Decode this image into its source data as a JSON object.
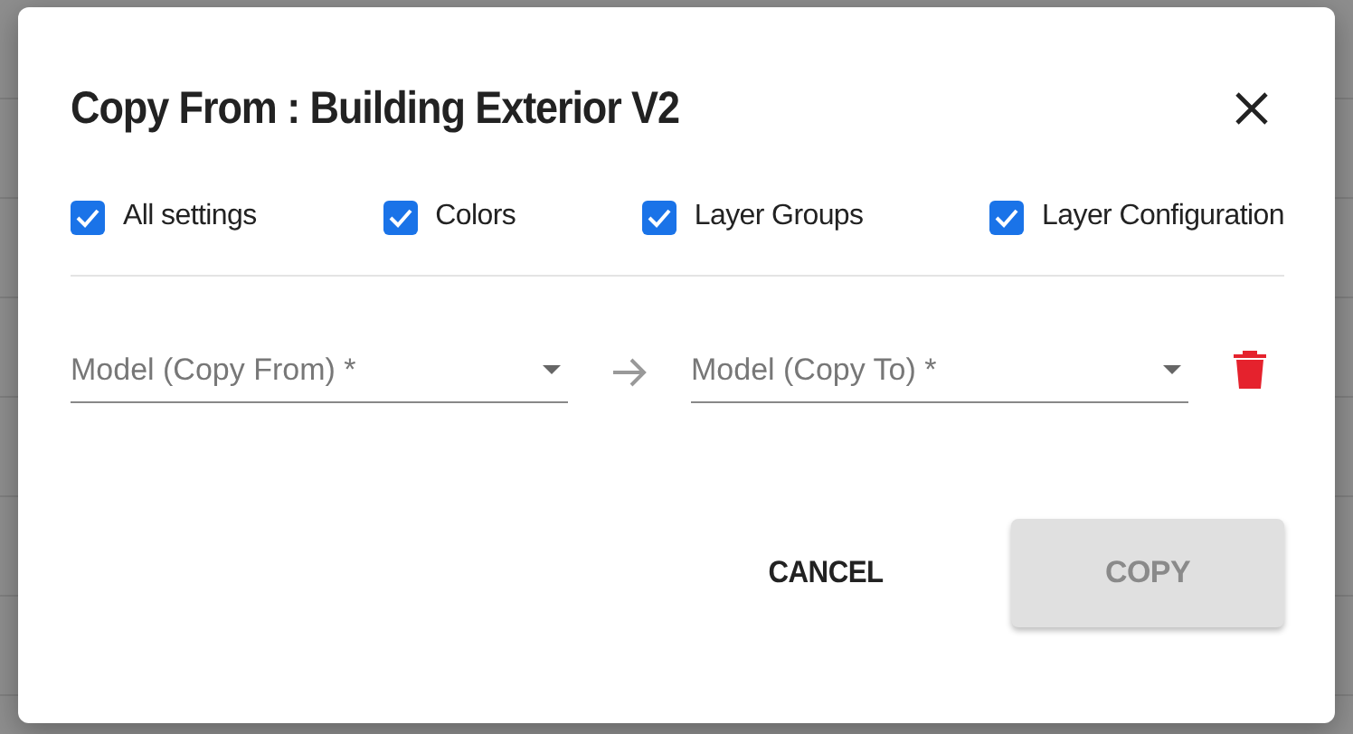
{
  "dialog": {
    "title": "Copy From : Building Exterior V2",
    "options": [
      {
        "label": "All settings",
        "checked": true
      },
      {
        "label": "Colors",
        "checked": true
      },
      {
        "label": "Layer Groups",
        "checked": true
      },
      {
        "label": "Layer Configuration",
        "checked": true
      }
    ],
    "fields": [
      {
        "placeholder": "Model (Copy From) *"
      },
      {
        "placeholder": "Model (Copy To) *"
      }
    ],
    "buttons": [
      {
        "label": "CANCEL",
        "disabled": false
      },
      {
        "label": "COPY",
        "disabled": true
      }
    ]
  }
}
